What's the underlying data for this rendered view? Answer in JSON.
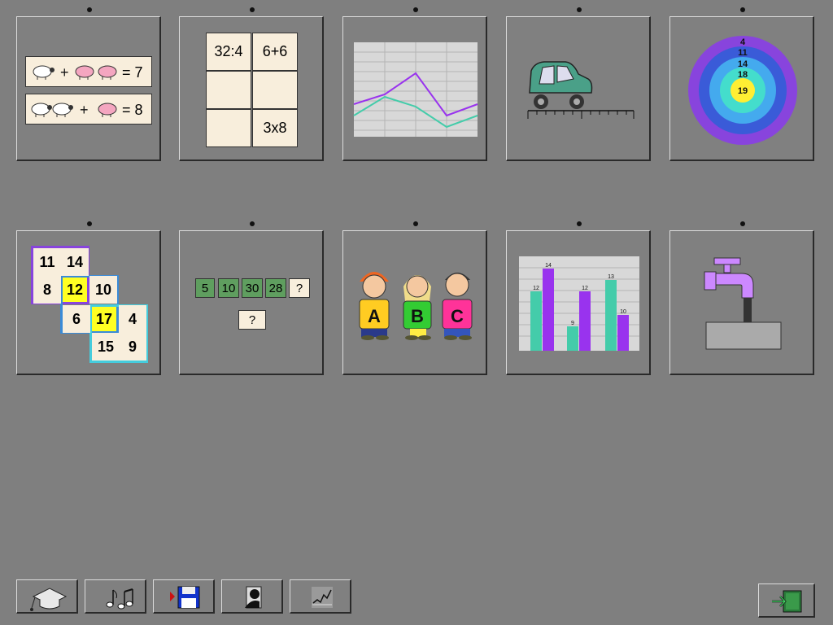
{
  "activities": {
    "sheep_pigs": {
      "equation1": {
        "result": "= 7"
      },
      "equation2": {
        "result": "= 8"
      },
      "plus": "+"
    },
    "operations_grid": {
      "cells": [
        "32:4",
        "6+6",
        "",
        "",
        "",
        "3x8"
      ]
    },
    "line_chart": {},
    "car_ruler": {},
    "target": {
      "ring_values": [
        "4",
        "11",
        "14",
        "18",
        "19"
      ],
      "ring_colors": [
        "#8844dd",
        "#3a5bd8",
        "#44aaee",
        "#44ddcc",
        "#ffee33"
      ]
    },
    "number_pyramid": {
      "cells": [
        "11",
        "14",
        "8",
        "12",
        "10",
        "6",
        "17",
        "4",
        "15",
        "9"
      ]
    },
    "sequence": {
      "items": [
        "5",
        "10",
        "30",
        "28",
        "?"
      ],
      "answer": "?"
    },
    "children_abc": {
      "labels": [
        "A",
        "B",
        "C"
      ]
    },
    "bar_chart": {
      "labels": [
        "12",
        "14",
        "9",
        "12",
        "13",
        "10"
      ]
    },
    "water_tap": {}
  },
  "toolbar": {
    "buttons": [
      "graduation-cap-icon",
      "music-notes-icon",
      "save-disk-icon",
      "person-icon",
      "chart-icon"
    ],
    "exit": "exit-door-icon"
  },
  "colors": {
    "background": "#7f7f7f",
    "cream": "#f8eedc",
    "teal": "#44ccaa",
    "purple": "#9933ee",
    "green_cell": "#5f9e5f"
  }
}
